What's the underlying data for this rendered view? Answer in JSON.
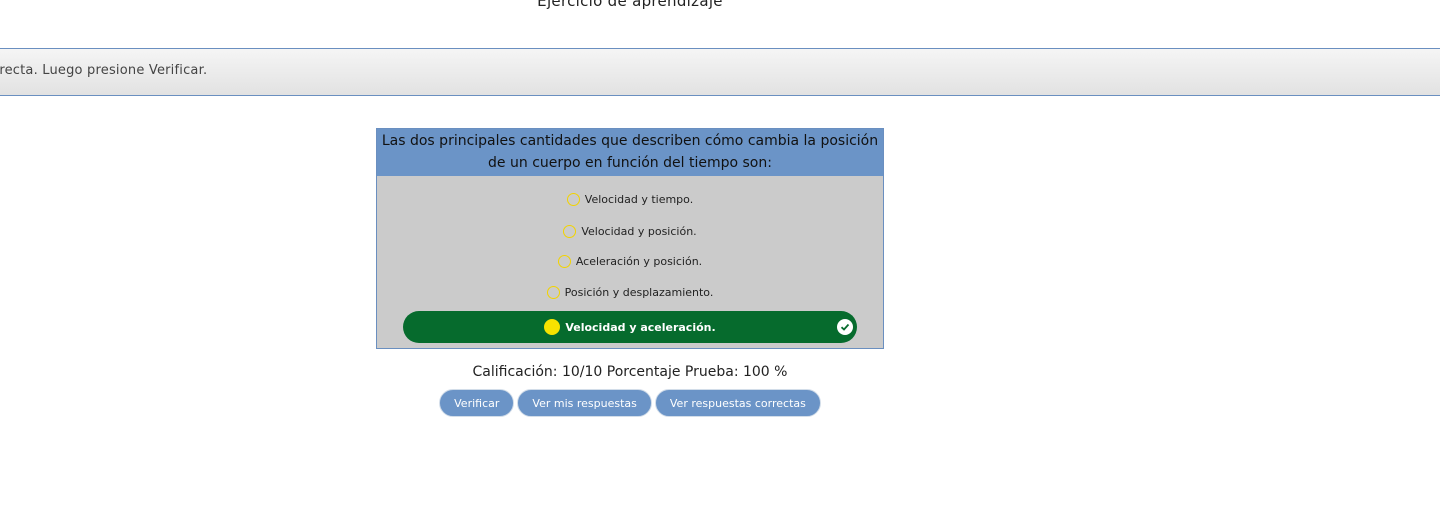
{
  "page": {
    "title": "Ejercicio de aprendizaje",
    "instruction": "rrecta. Luego presione Verificar."
  },
  "question": {
    "text": "Las dos principales cantidades que describen cómo cambia la posición de un cuerpo en función del tiempo son:",
    "options": [
      {
        "label": "Velocidad y tiempo.",
        "selected": false
      },
      {
        "label": "Velocidad y posición.",
        "selected": false
      },
      {
        "label": "Aceleración y posición.",
        "selected": false
      },
      {
        "label": "Posición y desplazamiento.",
        "selected": false
      },
      {
        "label": "Velocidad y aceleración.",
        "selected": true,
        "correct": true
      }
    ]
  },
  "result": {
    "score_text": "Calificación: 10/10 Porcentaje Prueba: 100 %"
  },
  "buttons": {
    "verify": "Verificar",
    "my_answers": "Ver mis respuestas",
    "correct_answers": "Ver respuestas correctas"
  },
  "colors": {
    "accent": "#6b94c7",
    "selected_bg": "#066b2d",
    "radio": "#f2d300",
    "card_bg": "#cbcbcb"
  },
  "icons": {
    "radio": "radio-circle-icon",
    "correct": "check-circle-icon"
  }
}
